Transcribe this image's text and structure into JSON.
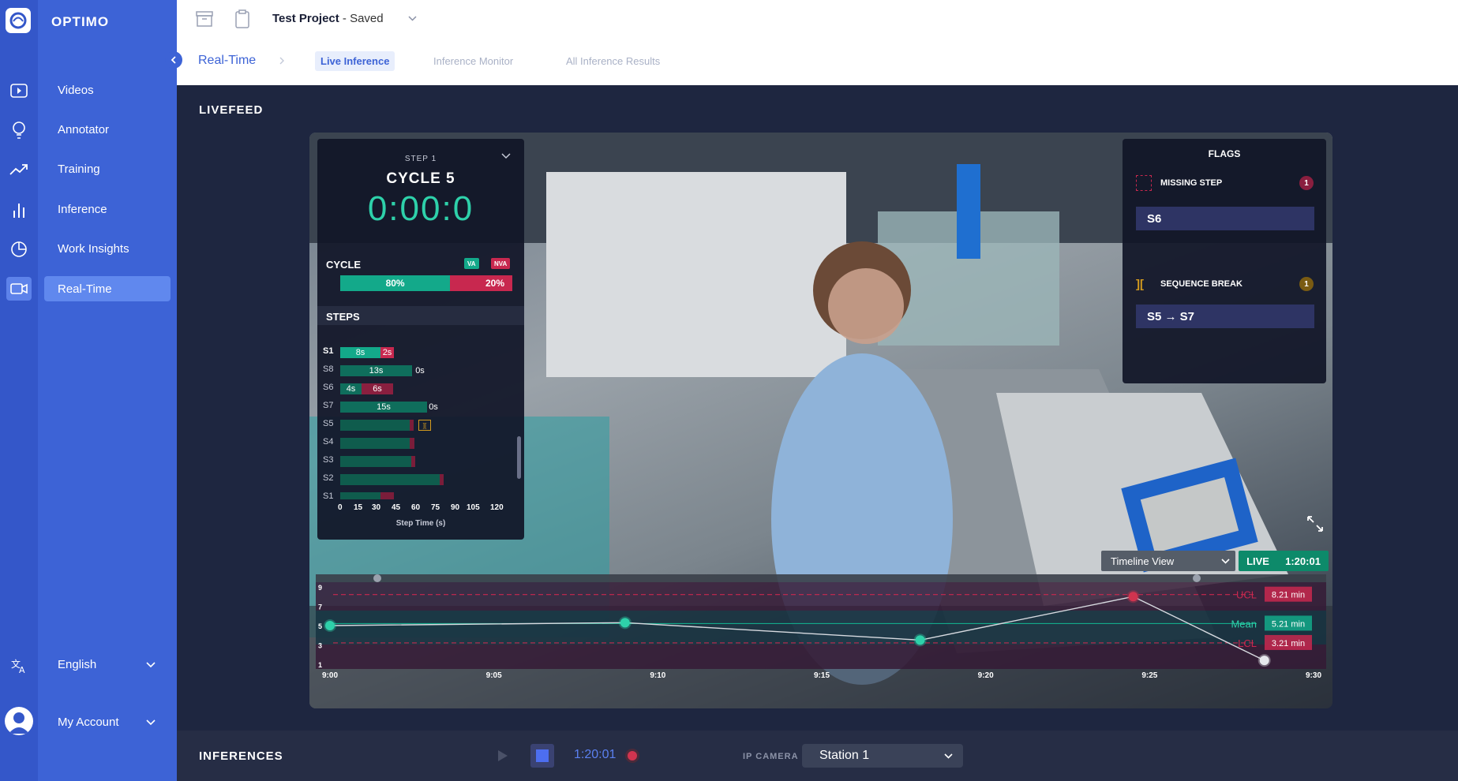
{
  "app": {
    "brand": "OPTIMO"
  },
  "sidebar": {
    "items": [
      {
        "label": "Videos",
        "icon": "video-icon"
      },
      {
        "label": "Annotator",
        "icon": "bulb-icon"
      },
      {
        "label": "Training",
        "icon": "trend-icon"
      },
      {
        "label": "Inference",
        "icon": "bar-chart-icon"
      },
      {
        "label": "Work Insights",
        "icon": "pie-chart-icon"
      },
      {
        "label": "Real-Time",
        "icon": "camera-icon",
        "active": true
      }
    ],
    "language": "English",
    "account": "My Account"
  },
  "topbar": {
    "project_name": "Test Project",
    "project_status": " - Saved",
    "breadcrumb_root": "Real-Time",
    "tabs": [
      {
        "label": "Live Inference",
        "active": true
      },
      {
        "label": "Inference Monitor"
      },
      {
        "label": "All Inference Results"
      }
    ]
  },
  "livefeed": {
    "title": "LIVEFEED",
    "step": "STEP 1",
    "cycle": "CYCLE 5",
    "timer": "0:00:0",
    "cycle_label": "CYCLE",
    "va_tag": "VA",
    "nva_tag": "NVA",
    "va_pct": "80%",
    "nva_pct": "20%",
    "va_fraction": 0.8,
    "steps_label": "STEPS",
    "steps": [
      {
        "label": "S1",
        "va": "8s",
        "nva": "2s"
      },
      {
        "label": "S8",
        "va": "13s",
        "nva": "0s"
      },
      {
        "label": "S6",
        "va": "4s",
        "nva": "6s"
      },
      {
        "label": "S7",
        "va": "15s",
        "nva": "0s"
      },
      {
        "label": "S5"
      },
      {
        "label": "S4"
      },
      {
        "label": "S3"
      },
      {
        "label": "S2"
      },
      {
        "label": "S1"
      }
    ],
    "axis_ticks": [
      "0",
      "15",
      "30",
      "45",
      "60",
      "75",
      "90",
      "105",
      "120"
    ],
    "axis_title": "Step Time (s)",
    "flags": {
      "title": "FLAGS",
      "missing": {
        "name": "MISSING STEP",
        "count": "1",
        "value": "S6"
      },
      "sequence": {
        "name": "SEQUENCE BREAK",
        "count": "1",
        "value": "S5 → S7"
      }
    },
    "timeline_view": "Timeline View",
    "live_label": "LIVE",
    "live_time": "1:20:01"
  },
  "chart_data": {
    "type": "line",
    "x": [
      "9:00",
      "9:05",
      "9:10",
      "9:15",
      "9:20",
      "9:25",
      "9:30"
    ],
    "y_ticks": [
      "9",
      "7",
      "5",
      "3",
      "1"
    ],
    "ylim": [
      1,
      9
    ],
    "points": [
      {
        "x": "9:00",
        "y": 5.0
      },
      {
        "x": "9:09",
        "y": 5.3
      },
      {
        "x": "9:18",
        "y": 3.5
      },
      {
        "x": "9:24.5",
        "y": 8.0
      },
      {
        "x": "9:28.5",
        "y": 1.4
      }
    ],
    "ucl": {
      "label": "UCL",
      "value": "8.21 min",
      "y": 8.21
    },
    "mean": {
      "label": "Mean",
      "value": "5.21 min",
      "y": 5.21
    },
    "lcl": {
      "label": "LCL",
      "value": "3.21 min",
      "y": 3.21
    }
  },
  "inferences": {
    "title": "INFERENCES",
    "time": "1:20:01",
    "camera_label": "IP CAMERA",
    "station": "Station 1"
  }
}
